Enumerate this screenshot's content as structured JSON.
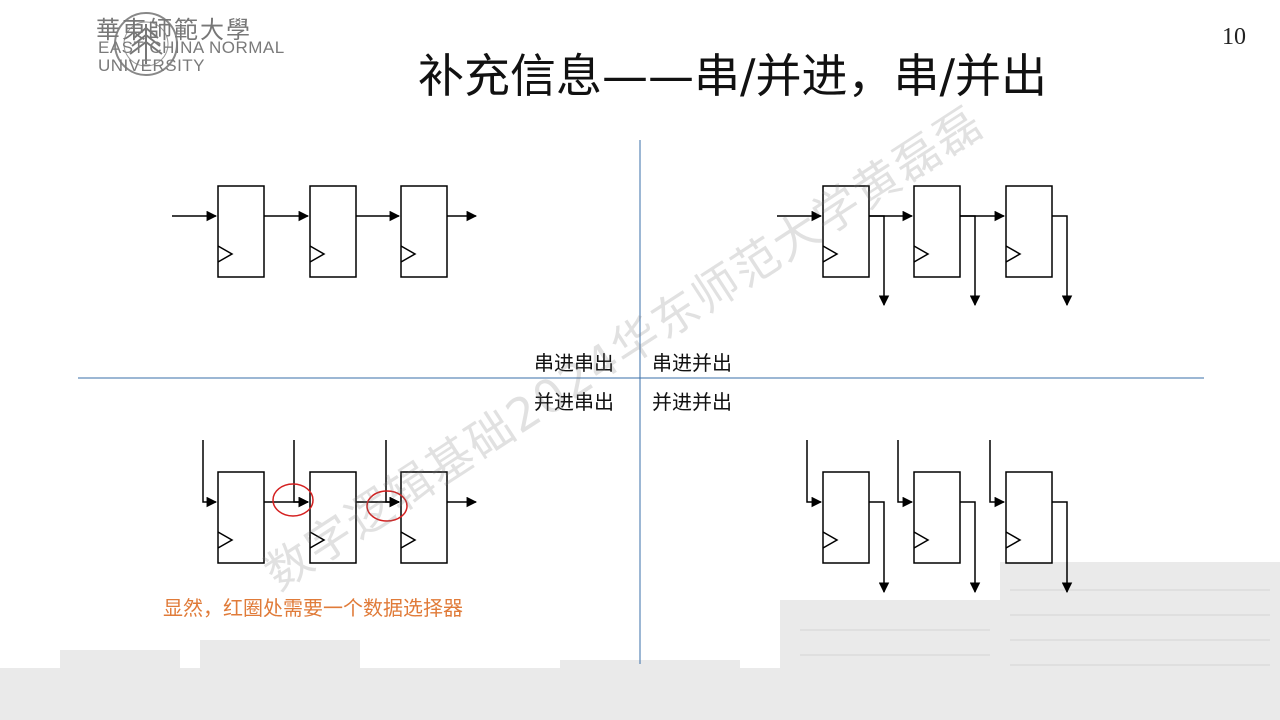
{
  "header": {
    "university_cn": "華東師範大學",
    "university_en_line1": "EAST CHINA NORMAL",
    "university_en_line2": "UNIVERSITY",
    "page_number": "10"
  },
  "slide": {
    "title": "补充信息——串/并进，串/并出",
    "quadrant_labels": {
      "top_left": "串进串出",
      "top_right": "串进并出",
      "bottom_left": "并进串出",
      "bottom_right": "并进并出"
    },
    "note": "显然，红圈处需要一个数据选择器",
    "watermark": "数字逻辑基础2024华东师范大学黄磊磊"
  },
  "colors": {
    "divider": "#3a6fa8",
    "highlight_circle": "#d42020",
    "note": "#e07b39",
    "title": "#111111"
  },
  "icons": [
    "university-logo-icon",
    "flip-flop-icon",
    "clock-triangle-icon",
    "arrow-icon"
  ]
}
